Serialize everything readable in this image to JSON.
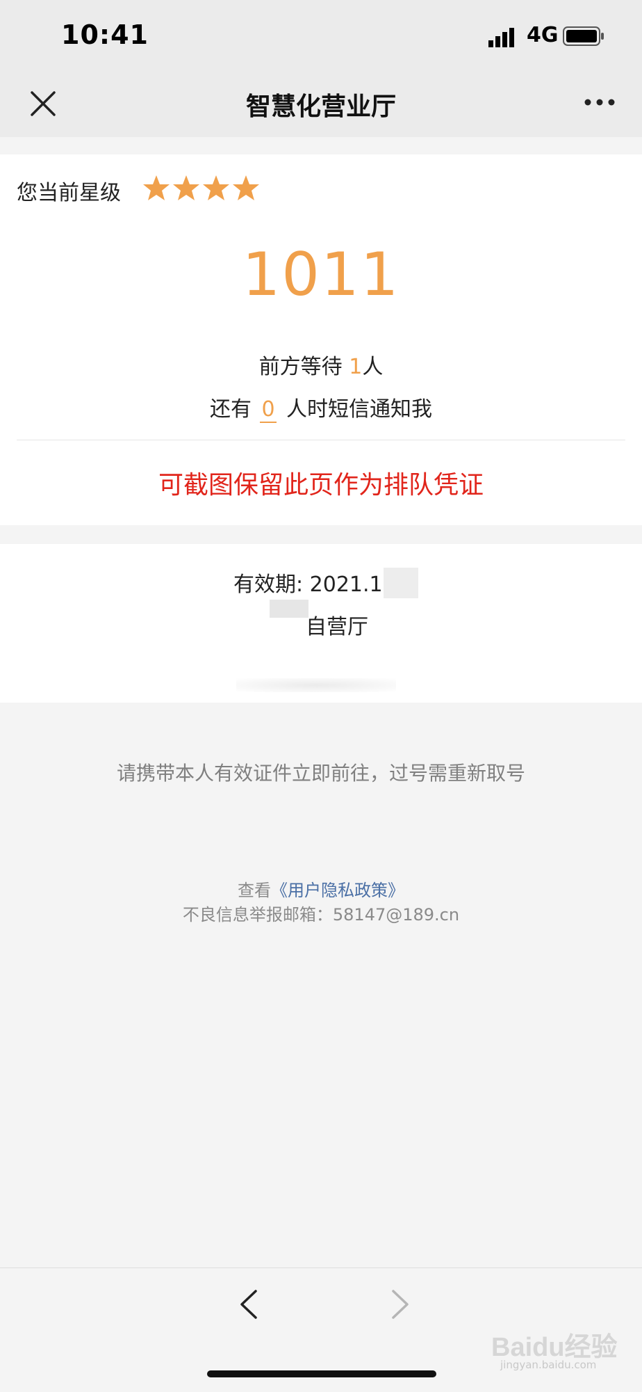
{
  "status_bar": {
    "time": "10:41",
    "network": "4G"
  },
  "nav": {
    "title": "智慧化营业厅",
    "close_icon": "close-icon",
    "more_icon": "more-dots-icon"
  },
  "rating": {
    "label": "您当前星级",
    "stars": 4,
    "star_color": "#f0a04b"
  },
  "queue": {
    "number": "1011",
    "waiting_prefix": "前方等待",
    "waiting_count": "1",
    "waiting_suffix": "人",
    "notify_prefix": "还有",
    "notify_count": "0",
    "notify_suffix": "人时短信通知我"
  },
  "screenshot_hint": "可截图保留此页作为排队凭证",
  "ticket": {
    "validity_label": "有效期: 2021.1",
    "hall_text": "自营厅"
  },
  "footer": {
    "bring_id_notice": "请携带本人有效证件立即前往，过号需重新取号",
    "privacy_prefix": "查看",
    "privacy_link": "《用户隐私政策》",
    "report_label": "不良信息举报邮箱：",
    "report_email": "58147@189.cn"
  },
  "toolbar": {
    "back_icon": "chevron-left-icon",
    "forward_icon": "chevron-right-icon"
  },
  "watermark": {
    "brand": "Baidu经验",
    "url": "jingyan.baidu.com"
  },
  "colors": {
    "accent": "#f0a04b",
    "warning_red": "#e1251b",
    "link_blue": "#4a6fa5"
  }
}
